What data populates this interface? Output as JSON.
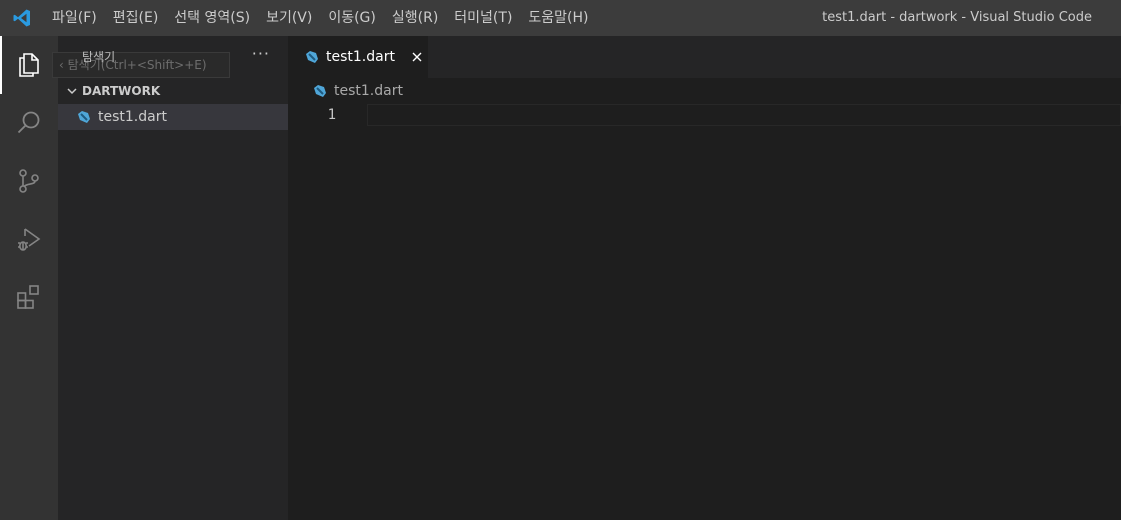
{
  "titlebar": {
    "logo_icon": "vscode-logo-icon",
    "menus": [
      "파일(F)",
      "편집(E)",
      "선택 영역(S)",
      "보기(V)",
      "이동(G)",
      "실행(R)",
      "터미널(T)",
      "도움말(H)"
    ],
    "window_title": "test1.dart - dartwork - Visual Studio Code"
  },
  "activitybar": {
    "items": [
      "explorer-icon",
      "search-icon",
      "source-control-icon",
      "run-debug-icon",
      "extensions-icon"
    ],
    "active": "explorer-icon"
  },
  "sidebar": {
    "title": "탐색기",
    "hint": "탐색기(Ctrl+<Shift>+E)",
    "more": "···",
    "folder": "DARTWORK",
    "files": [
      "test1.dart"
    ]
  },
  "editor": {
    "tab_label": "test1.dart",
    "breadcrumb": "test1.dart",
    "line_number": "1"
  },
  "colors": {
    "titlebar": "#3c3c3c",
    "activitybar": "#333333",
    "sidebar": "#252526",
    "editor": "#1e1e1e",
    "dart_blue": "#4fa6d8",
    "vscode_blue": "#2a9ae0"
  }
}
